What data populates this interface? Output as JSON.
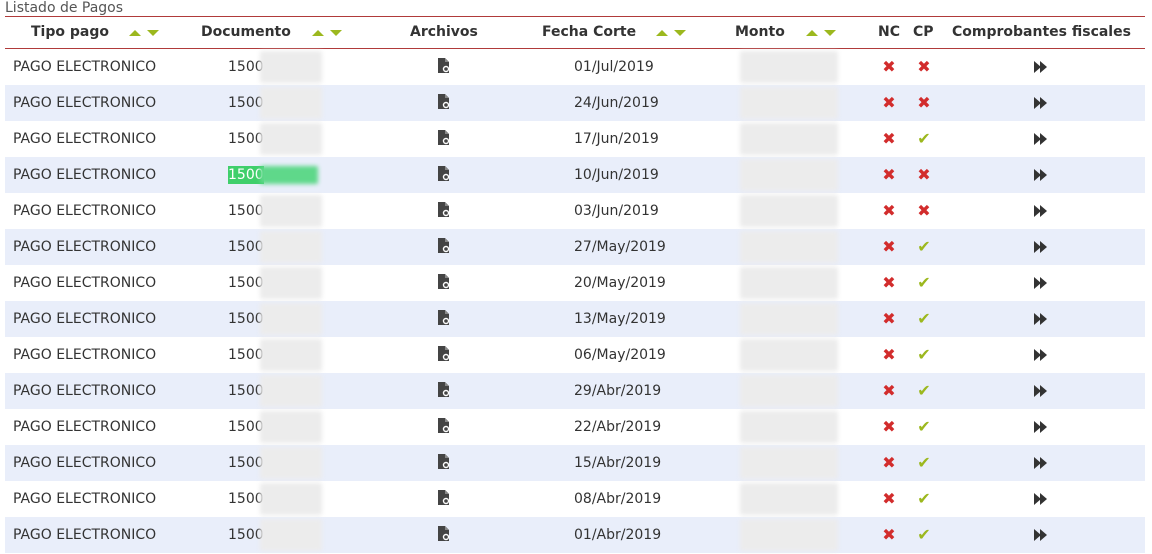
{
  "caption": "Listado de Pagos",
  "columns": {
    "tipo_pago": "Tipo pago",
    "documento": "Documento",
    "archivos": "Archivos",
    "fecha_corte": "Fecha Corte",
    "monto": "Monto",
    "nc": "NC",
    "cp": "CP",
    "comprobantes": "Comprobantes fiscales"
  },
  "colors": {
    "header_border": "#b03a3a",
    "sort_arrow": "#9cb81e",
    "row_alt": "#e9eefa",
    "x_mark": "#d22c2c",
    "check_mark": "#9cb81e",
    "highlight": "#3fcf6b"
  },
  "rows": [
    {
      "tipo": "PAGO ELECTRONICO",
      "doc": "1500",
      "fecha": "01/Jul/2019",
      "nc": "x",
      "cp": "x"
    },
    {
      "tipo": "PAGO ELECTRONICO",
      "doc": "1500",
      "fecha": "24/Jun/2019",
      "nc": "x",
      "cp": "x"
    },
    {
      "tipo": "PAGO ELECTRONICO",
      "doc": "1500",
      "fecha": "17/Jun/2019",
      "nc": "x",
      "cp": "check"
    },
    {
      "tipo": "PAGO ELECTRONICO",
      "doc": "1500",
      "fecha": "10/Jun/2019",
      "nc": "x",
      "cp": "x",
      "highlighted": true
    },
    {
      "tipo": "PAGO ELECTRONICO",
      "doc": "1500",
      "fecha": "03/Jun/2019",
      "nc": "x",
      "cp": "x"
    },
    {
      "tipo": "PAGO ELECTRONICO",
      "doc": "1500",
      "fecha": "27/May/2019",
      "nc": "x",
      "cp": "check"
    },
    {
      "tipo": "PAGO ELECTRONICO",
      "doc": "1500",
      "fecha": "20/May/2019",
      "nc": "x",
      "cp": "check"
    },
    {
      "tipo": "PAGO ELECTRONICO",
      "doc": "1500",
      "fecha": "13/May/2019",
      "nc": "x",
      "cp": "check"
    },
    {
      "tipo": "PAGO ELECTRONICO",
      "doc": "1500",
      "fecha": "06/May/2019",
      "nc": "x",
      "cp": "check"
    },
    {
      "tipo": "PAGO ELECTRONICO",
      "doc": "1500",
      "fecha": "29/Abr/2019",
      "nc": "x",
      "cp": "check"
    },
    {
      "tipo": "PAGO ELECTRONICO",
      "doc": "1500",
      "fecha": "22/Abr/2019",
      "nc": "x",
      "cp": "check"
    },
    {
      "tipo": "PAGO ELECTRONICO",
      "doc": "1500",
      "fecha": "15/Abr/2019",
      "nc": "x",
      "cp": "check"
    },
    {
      "tipo": "PAGO ELECTRONICO",
      "doc": "1500",
      "fecha": "08/Abr/2019",
      "nc": "x",
      "cp": "check"
    },
    {
      "tipo": "PAGO ELECTRONICO",
      "doc": "1500",
      "fecha": "01/Abr/2019",
      "nc": "x",
      "cp": "check"
    }
  ]
}
